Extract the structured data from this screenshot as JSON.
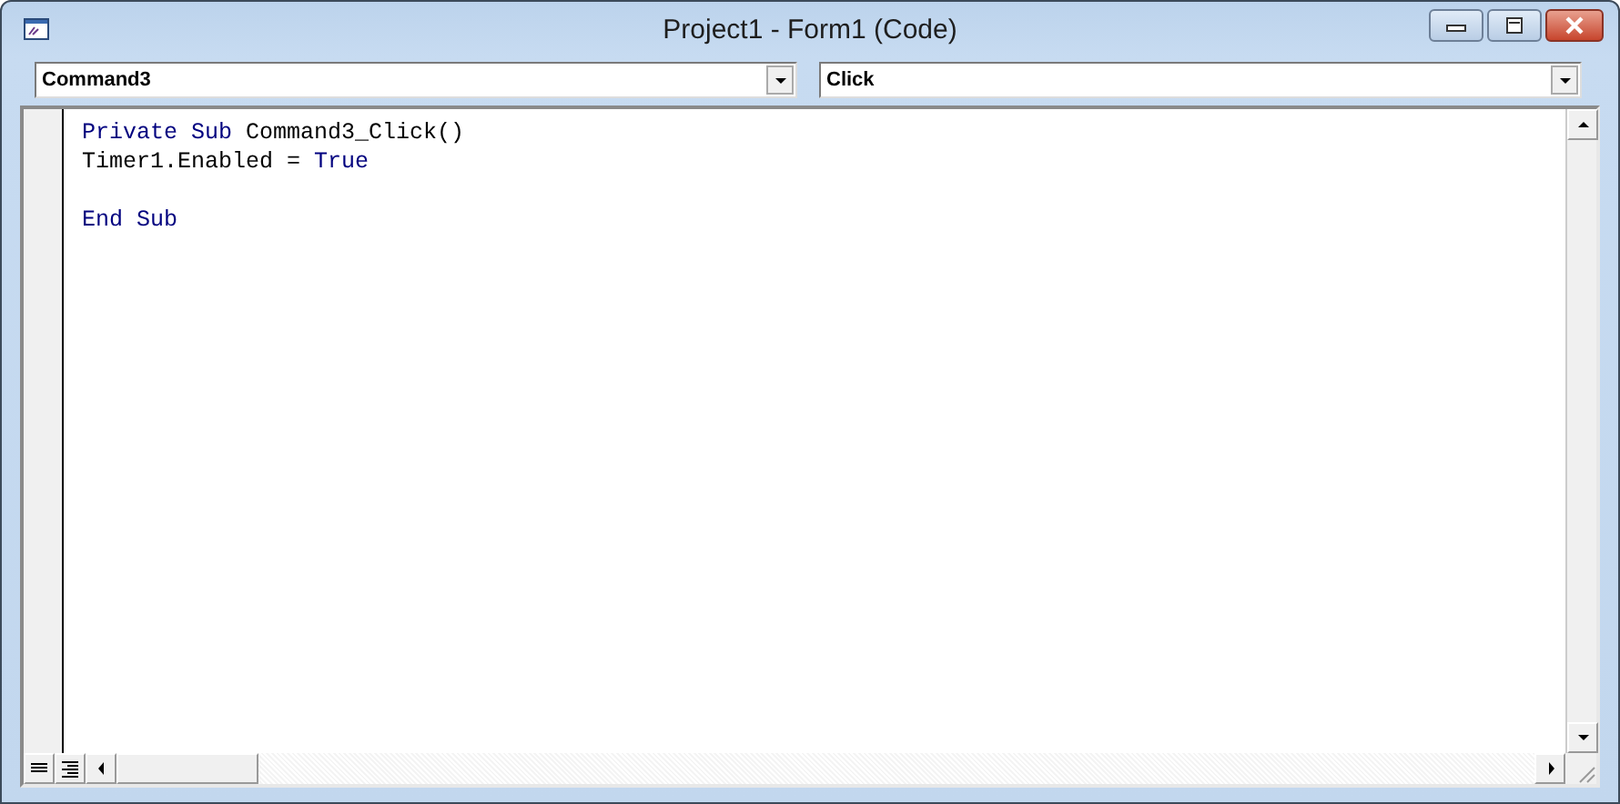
{
  "window": {
    "title": "Project1 - Form1 (Code)"
  },
  "object_dropdown": {
    "value": "Command3"
  },
  "procedure_dropdown": {
    "value": "Click"
  },
  "code": {
    "lines": [
      {
        "kind": "code",
        "tokens": [
          {
            "kind": "keyword",
            "text": "Private Sub"
          },
          {
            "kind": "plain",
            "text": "Command3_Click()"
          }
        ]
      },
      {
        "kind": "code",
        "tokens": [
          {
            "kind": "plain",
            "text": "Timer1.Enabled ="
          },
          {
            "kind": "keyword",
            "text": "True"
          }
        ]
      },
      {
        "kind": "blank"
      },
      {
        "kind": "code",
        "tokens": [
          {
            "kind": "keyword",
            "text": "End Sub"
          }
        ]
      }
    ]
  }
}
